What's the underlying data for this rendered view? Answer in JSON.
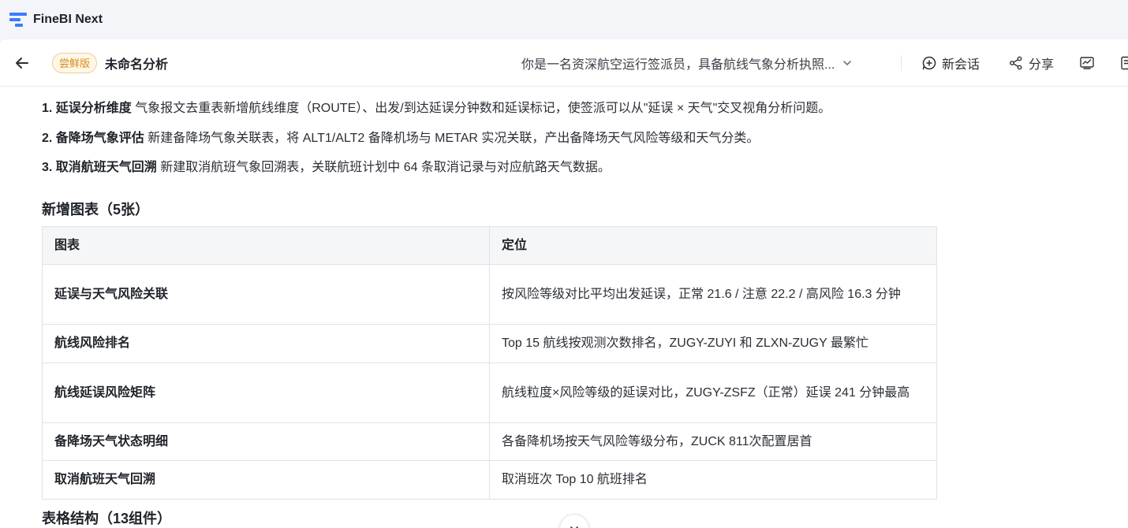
{
  "app": {
    "name": "FineBI Next",
    "brand_color": "#3b7cff"
  },
  "header": {
    "badge": "尝鲜版",
    "title": "未命名分析",
    "prompt": "你是一名资深航空运行签派员，具备航线气象分析执照...",
    "new_session": "新会话",
    "share": "分享"
  },
  "items": [
    {
      "label": "1. 延误分析维度",
      "text": " 气象报文去重表新增航线维度（ROUTE）、出发/到达延误分钟数和延误标记，使签派可以从\"延误 × 天气\"交叉视角分析问题。"
    },
    {
      "label": "2. 备降场气象评估",
      "text": " 新建备降场气象关联表，将 ALT1/ALT2 备降机场与 METAR 实况关联，产出备降场天气风险等级和天气分类。"
    },
    {
      "label": "3. 取消航班天气回溯",
      "text": " 新建取消航班气象回溯表，关联航班计划中 64 条取消记录与对应航路天气数据。"
    }
  ],
  "charts_heading": "新增图表（5张）",
  "table": {
    "headers": [
      "图表",
      "定位"
    ],
    "rows": [
      [
        "延误与天气风险关联",
        "按风险等级对比平均出发延误，正常 21.6 / 注意 22.2 / 高风险 16.3 分钟"
      ],
      [
        "航线风险排名",
        "Top 15 航线按观测次数排名，ZUGY-ZUYI 和 ZLXN-ZUGY 最繁忙"
      ],
      [
        "航线延误风险矩阵",
        "航线粒度×风险等级的延误对比，ZUGY-ZSFZ（正常）延误 241 分钟最高"
      ],
      [
        "备降场天气状态明细",
        "各备降机场按天气风险等级分布，ZUCK 811次配置居首"
      ],
      [
        "取消航班天气回溯",
        "取消班次 Top 10 航班排名"
      ]
    ]
  },
  "next_heading": "表格结构（13组件）"
}
